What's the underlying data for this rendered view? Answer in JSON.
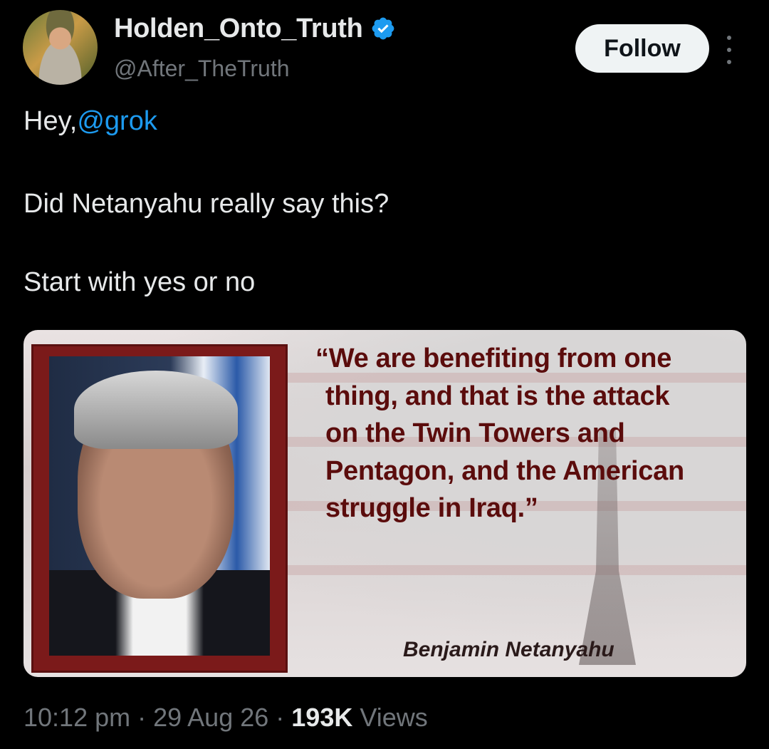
{
  "author": {
    "display_name": "Holden_Onto_Truth",
    "handle": "@After_TheTruth",
    "verified_icon": "verified-badge-icon",
    "avatar_icon": "profile-photo"
  },
  "actions": {
    "follow_label": "Follow",
    "more_icon": "more-vertical-icon"
  },
  "tweet": {
    "greeting": "Hey,",
    "mention": "@grok",
    "line2": "Did Netanyahu really say this?",
    "line3": "Start with yes or no"
  },
  "media": {
    "quote": "“We are benefiting from one thing, and that is the attack on the Twin Towers and Pentagon, and the American struggle in Iraq.”",
    "attribution": "Benjamin Netanyahu"
  },
  "meta": {
    "time": "10:12 pm",
    "sep1": "·",
    "date": "29 Aug 26",
    "sep2": "·",
    "views_count": "193K",
    "views_label": "Views"
  },
  "colors": {
    "background": "#000000",
    "text": "#e7e9ea",
    "secondary": "#71767b",
    "link": "#1d9bf0",
    "verified": "#1d9bf0"
  }
}
